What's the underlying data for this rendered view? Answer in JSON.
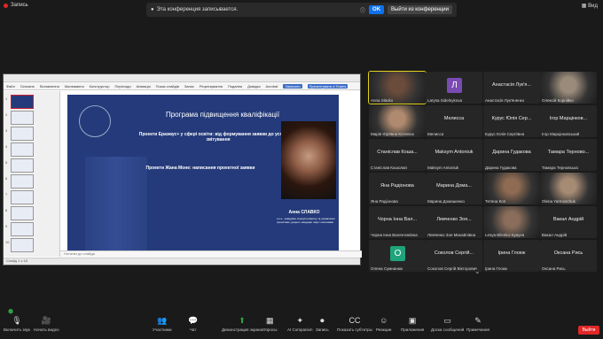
{
  "top": {
    "recording_label": "Запись",
    "view_label": "Вид",
    "banner_message": "Эта конференция записывается.",
    "ok_label": "OK",
    "leave_label": "Выйти из конференции"
  },
  "share": {
    "ribbon_tabs": [
      "Файл",
      "Основне",
      "Вставлення",
      "Малювання",
      "Конструктор",
      "Переходи",
      "Анімація",
      "Показ слайдів",
      "Запис",
      "Рецензування",
      "Подання",
      "Довідка",
      "Acrobat"
    ],
    "record_btn": "Записати",
    "present_btn": "Презентувати в Teams",
    "slide": {
      "title": "Програма підвищення кваліфікації",
      "line1": "Проекти Еразмус+ у сфері освіти: від формування заявки до успішного звітування",
      "line2": "Проекти Жана Моне: написання проектної заявки",
      "name": "Анна СЛАВКО",
      "small": "к.е.н., завідувач Агенції розвитку та управління проектами, доцент, кандидат наук з економіки"
    },
    "notes_placeholder": "Нотатки до слайда",
    "status_text": "Слайд 1 з 18",
    "thumb_numbers": [
      "1",
      "2",
      "3",
      "4",
      "5",
      "6",
      "7",
      "8",
      "9",
      "10"
    ]
  },
  "gallery": [
    {
      "name": "Anna Slavko",
      "type": "photo",
      "speaking": true,
      "color": "#6b4b3a"
    },
    {
      "name": "Larysa Sidelnykova",
      "type": "avatar",
      "letter": "Л",
      "color": "#7a4bb3"
    },
    {
      "name": "Анастасія Лук'яненко",
      "title": "Анастасія Лук'я...",
      "type": "name"
    },
    {
      "name": "Олексій Корнійко",
      "type": "photo",
      "color": "#9b8b7a"
    },
    {
      "name": "Марія Юріївна Котелюх",
      "type": "photo",
      "color": "#b08a6e"
    },
    {
      "name": "Мелисса",
      "title": "Мелисса",
      "type": "name"
    },
    {
      "name": "Курус Юлія Сергіївна",
      "title": "Курус Юлія Сер...",
      "type": "name"
    },
    {
      "name": "Ігор Марцінковський",
      "title": "Ігор Марцінков...",
      "type": "name"
    },
    {
      "name": "Станіслав Кошолап",
      "title": "Станіслав Коша...",
      "type": "name"
    },
    {
      "name": "Maksym Antoniuk",
      "title": "Maksym Antoniuk",
      "type": "name"
    },
    {
      "name": "Дарина Гудакова",
      "title": "Дарина Гудакова",
      "type": "name"
    },
    {
      "name": "Тамара Терновська",
      "title": "Тамара Терново...",
      "type": "name"
    },
    {
      "name": "Яна Радіонова",
      "title": "Яна Радіонова",
      "type": "name"
    },
    {
      "name": "Марина Домашенко",
      "title": "Марина Дома...",
      "type": "name"
    },
    {
      "name": "Тетяна Коп",
      "type": "photo",
      "color": "#8e6b52"
    },
    {
      "name": "Olena Yarmoschuk",
      "type": "photo",
      "color": "#a58a74"
    },
    {
      "name": "Чорна Інна Валентинівна",
      "title": "Чорна Інна Вал...",
      "type": "name"
    },
    {
      "name": "Левченко Зоя Михайлівна",
      "title": "Левченко Зоя...",
      "type": "name"
    },
    {
      "name": "Lesya Bilenko-Syayva",
      "type": "photo",
      "color": "#8a6d5b"
    },
    {
      "name": "Вакал Андрій",
      "title": "Вакал Андрій",
      "type": "name"
    },
    {
      "name": "Олена Сумнанюк",
      "type": "avatar",
      "letter": "О",
      "color": "#1fa37a"
    },
    {
      "name": "Соколов Сергій Вікторович",
      "title": "Соколов Сергій...",
      "type": "name"
    },
    {
      "name": "Ірина Глоюк",
      "title": "Ірина Глоюк",
      "type": "name"
    },
    {
      "name": "Оксана Рись",
      "title": "Оксана Рись",
      "type": "name"
    }
  ],
  "toolbar": [
    {
      "label": "Включить звук",
      "icon": "mic-off-icon",
      "glyph": "🎙"
    },
    {
      "label": "Начать видео",
      "icon": "video-off-icon",
      "glyph": "🎥"
    },
    {
      "label": "Участники",
      "icon": "participants-icon",
      "glyph": "👥"
    },
    {
      "label": "Чат",
      "icon": "chat-icon",
      "glyph": "💬"
    },
    {
      "label": "Демонстрация экрана",
      "icon": "share-screen-icon",
      "glyph": "⬆"
    },
    {
      "label": "Опросы",
      "icon": "polls-icon",
      "glyph": "▦"
    },
    {
      "label": "AI Companion",
      "icon": "ai-companion-icon",
      "glyph": "✦"
    },
    {
      "label": "Запись",
      "icon": "record-icon",
      "glyph": "⏺"
    },
    {
      "label": "Показать субтитры",
      "icon": "captions-icon",
      "glyph": "CC"
    },
    {
      "label": "Реакции",
      "icon": "reactions-icon",
      "glyph": "☺"
    },
    {
      "label": "Приложения",
      "icon": "apps-icon",
      "glyph": "▣"
    },
    {
      "label": "Доска сообщений",
      "icon": "whiteboard-icon",
      "glyph": "▭"
    },
    {
      "label": "Примечания",
      "icon": "notes-icon",
      "glyph": "✎"
    }
  ],
  "end_label": "Выйти",
  "colors": {
    "accent": "#0e72ed",
    "end": "#e02828",
    "speaking": "#e2d21b",
    "slide_bg": "#243a7a"
  }
}
